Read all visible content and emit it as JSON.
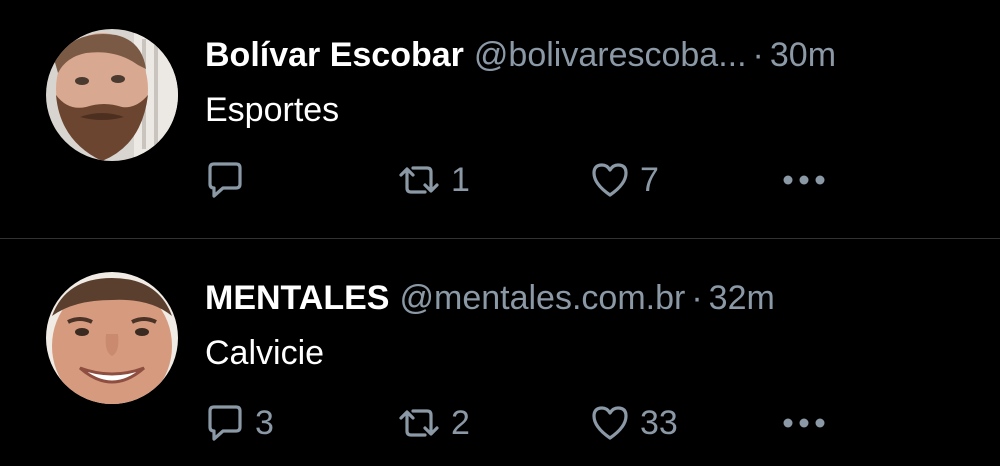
{
  "theme": {
    "background": "#000000",
    "text": "#ffffff",
    "muted": "#8b98a5",
    "divider": "#2f3336"
  },
  "tweets": [
    {
      "name": "Bolívar Escobar",
      "handle": "@bolivarescoba...",
      "separator": "·",
      "time": "30m",
      "text": "Esportes",
      "reply_count": "",
      "retweet_count": "1",
      "like_count": "7",
      "avatar_icon": "bearded-man-avatar"
    },
    {
      "name": "MENTALES",
      "handle": "@mentales.com.br",
      "separator": "·",
      "time": "32m",
      "text": "Calvicie",
      "reply_count": "3",
      "retweet_count": "2",
      "like_count": "33",
      "avatar_icon": "smiling-man-avatar"
    }
  ],
  "icons": {
    "reply": "reply-icon",
    "retweet": "retweet-icon",
    "like": "heart-icon",
    "more": "more-icon"
  }
}
